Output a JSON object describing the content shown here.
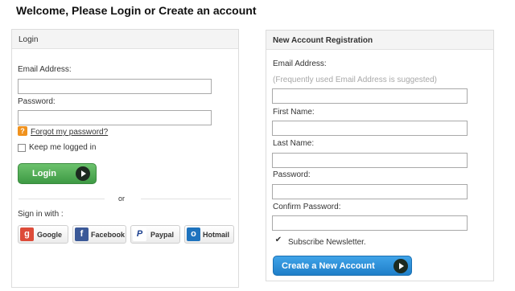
{
  "page": {
    "title": "Welcome, Please Login or Create an account"
  },
  "login": {
    "header": "Login",
    "email_label": "Email Address:",
    "email_value": "",
    "password_label": "Password:",
    "password_value": "",
    "forgot_link": "Forgot my password?",
    "keep_logged_in": "Keep me logged in",
    "keep_logged_in_checked": false,
    "login_button": "Login",
    "or_text": "or",
    "sign_in_with": "Sign in with :",
    "social": [
      {
        "label": "Google",
        "icon": "g",
        "color": "#dd4b39"
      },
      {
        "label": "Facebook",
        "icon": "f",
        "color": "#3b5998"
      },
      {
        "label": "Paypal",
        "icon": "P",
        "color": "#1a3f8f"
      },
      {
        "label": "Hotmail",
        "icon": "o",
        "color": "#1e73be"
      }
    ]
  },
  "registration": {
    "header": "New Account Registration",
    "email_label": "Email Address:",
    "email_hint": "(Frequently used Email Address is suggested)",
    "first_name_label": "First Name:",
    "last_name_label": "Last Name:",
    "password_label": "Password:",
    "confirm_password_label": "Confirm Password:",
    "subscribe_label": "Subscribe Newsletter.",
    "subscribe_checked": true,
    "create_button": "Create a New Account"
  }
}
